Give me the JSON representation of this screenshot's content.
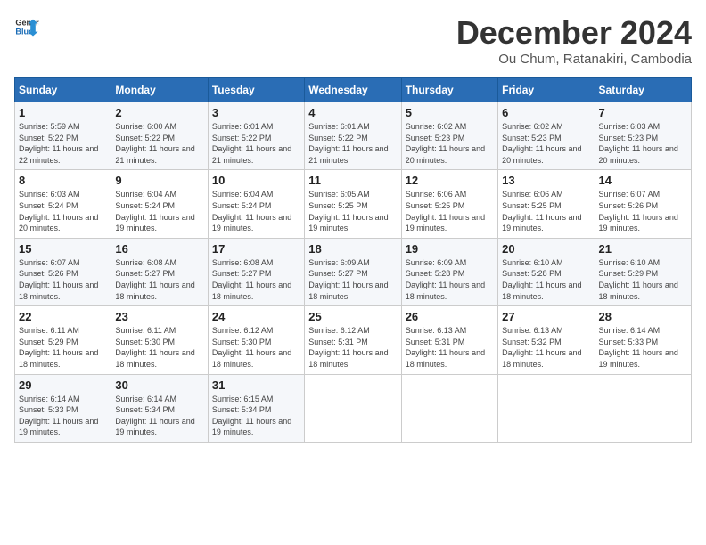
{
  "logo": {
    "line1": "General",
    "line2": "Blue"
  },
  "title": "December 2024",
  "location": "Ou Chum, Ratanakiri, Cambodia",
  "weekdays": [
    "Sunday",
    "Monday",
    "Tuesday",
    "Wednesday",
    "Thursday",
    "Friday",
    "Saturday"
  ],
  "weeks": [
    [
      {
        "day": "1",
        "rise": "5:59 AM",
        "set": "5:22 PM",
        "daylight": "11 hours and 22 minutes."
      },
      {
        "day": "2",
        "rise": "6:00 AM",
        "set": "5:22 PM",
        "daylight": "11 hours and 21 minutes."
      },
      {
        "day": "3",
        "rise": "6:01 AM",
        "set": "5:22 PM",
        "daylight": "11 hours and 21 minutes."
      },
      {
        "day": "4",
        "rise": "6:01 AM",
        "set": "5:22 PM",
        "daylight": "11 hours and 21 minutes."
      },
      {
        "day": "5",
        "rise": "6:02 AM",
        "set": "5:23 PM",
        "daylight": "11 hours and 20 minutes."
      },
      {
        "day": "6",
        "rise": "6:02 AM",
        "set": "5:23 PM",
        "daylight": "11 hours and 20 minutes."
      },
      {
        "day": "7",
        "rise": "6:03 AM",
        "set": "5:23 PM",
        "daylight": "11 hours and 20 minutes."
      }
    ],
    [
      {
        "day": "8",
        "rise": "6:03 AM",
        "set": "5:24 PM",
        "daylight": "11 hours and 20 minutes."
      },
      {
        "day": "9",
        "rise": "6:04 AM",
        "set": "5:24 PM",
        "daylight": "11 hours and 19 minutes."
      },
      {
        "day": "10",
        "rise": "6:04 AM",
        "set": "5:24 PM",
        "daylight": "11 hours and 19 minutes."
      },
      {
        "day": "11",
        "rise": "6:05 AM",
        "set": "5:25 PM",
        "daylight": "11 hours and 19 minutes."
      },
      {
        "day": "12",
        "rise": "6:06 AM",
        "set": "5:25 PM",
        "daylight": "11 hours and 19 minutes."
      },
      {
        "day": "13",
        "rise": "6:06 AM",
        "set": "5:25 PM",
        "daylight": "11 hours and 19 minutes."
      },
      {
        "day": "14",
        "rise": "6:07 AM",
        "set": "5:26 PM",
        "daylight": "11 hours and 19 minutes."
      }
    ],
    [
      {
        "day": "15",
        "rise": "6:07 AM",
        "set": "5:26 PM",
        "daylight": "11 hours and 18 minutes."
      },
      {
        "day": "16",
        "rise": "6:08 AM",
        "set": "5:27 PM",
        "daylight": "11 hours and 18 minutes."
      },
      {
        "day": "17",
        "rise": "6:08 AM",
        "set": "5:27 PM",
        "daylight": "11 hours and 18 minutes."
      },
      {
        "day": "18",
        "rise": "6:09 AM",
        "set": "5:27 PM",
        "daylight": "11 hours and 18 minutes."
      },
      {
        "day": "19",
        "rise": "6:09 AM",
        "set": "5:28 PM",
        "daylight": "11 hours and 18 minutes."
      },
      {
        "day": "20",
        "rise": "6:10 AM",
        "set": "5:28 PM",
        "daylight": "11 hours and 18 minutes."
      },
      {
        "day": "21",
        "rise": "6:10 AM",
        "set": "5:29 PM",
        "daylight": "11 hours and 18 minutes."
      }
    ],
    [
      {
        "day": "22",
        "rise": "6:11 AM",
        "set": "5:29 PM",
        "daylight": "11 hours and 18 minutes."
      },
      {
        "day": "23",
        "rise": "6:11 AM",
        "set": "5:30 PM",
        "daylight": "11 hours and 18 minutes."
      },
      {
        "day": "24",
        "rise": "6:12 AM",
        "set": "5:30 PM",
        "daylight": "11 hours and 18 minutes."
      },
      {
        "day": "25",
        "rise": "6:12 AM",
        "set": "5:31 PM",
        "daylight": "11 hours and 18 minutes."
      },
      {
        "day": "26",
        "rise": "6:13 AM",
        "set": "5:31 PM",
        "daylight": "11 hours and 18 minutes."
      },
      {
        "day": "27",
        "rise": "6:13 AM",
        "set": "5:32 PM",
        "daylight": "11 hours and 18 minutes."
      },
      {
        "day": "28",
        "rise": "6:14 AM",
        "set": "5:33 PM",
        "daylight": "11 hours and 19 minutes."
      }
    ],
    [
      {
        "day": "29",
        "rise": "6:14 AM",
        "set": "5:33 PM",
        "daylight": "11 hours and 19 minutes."
      },
      {
        "day": "30",
        "rise": "6:14 AM",
        "set": "5:34 PM",
        "daylight": "11 hours and 19 minutes."
      },
      {
        "day": "31",
        "rise": "6:15 AM",
        "set": "5:34 PM",
        "daylight": "11 hours and 19 minutes."
      },
      null,
      null,
      null,
      null
    ]
  ],
  "labels": {
    "sunrise": "Sunrise:",
    "sunset": "Sunset:",
    "daylight": "Daylight:"
  }
}
